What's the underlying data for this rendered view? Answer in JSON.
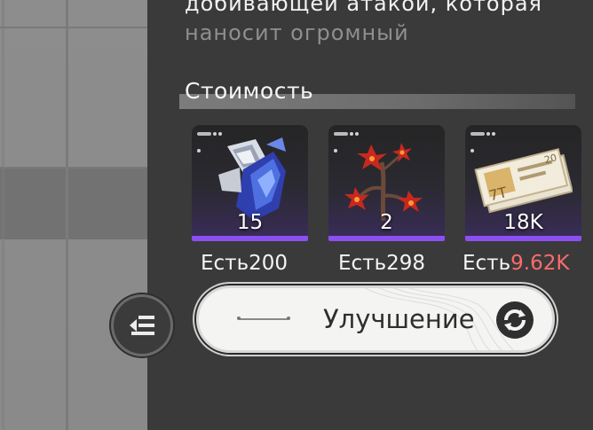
{
  "description": {
    "line1": "добивающей атакой, которая",
    "line2": "наносит огромный"
  },
  "cost": {
    "title": "Стоимость",
    "items": [
      {
        "icon": "crystal-ore-icon",
        "qty": "15",
        "have_label": "Есть",
        "have_value": "200",
        "sufficient": true
      },
      {
        "icon": "red-flower-icon",
        "qty": "2",
        "have_label": "Есть",
        "have_value": "298",
        "sufficient": true
      },
      {
        "icon": "money-bills-icon",
        "qty": "18K",
        "have_label": "Есть",
        "have_value": "9.62K",
        "sufficient": false
      }
    ]
  },
  "upgrade": {
    "label": "Улучшение",
    "icon": "refresh-icon"
  },
  "collapse": {
    "icon": "collapse-list-icon"
  },
  "colors": {
    "panel_bg": "#3a3a3a",
    "rarity_purple": "#8c4ff2",
    "insufficient_red": "#ff6b6b",
    "button_bg": "#f4f4f2"
  }
}
